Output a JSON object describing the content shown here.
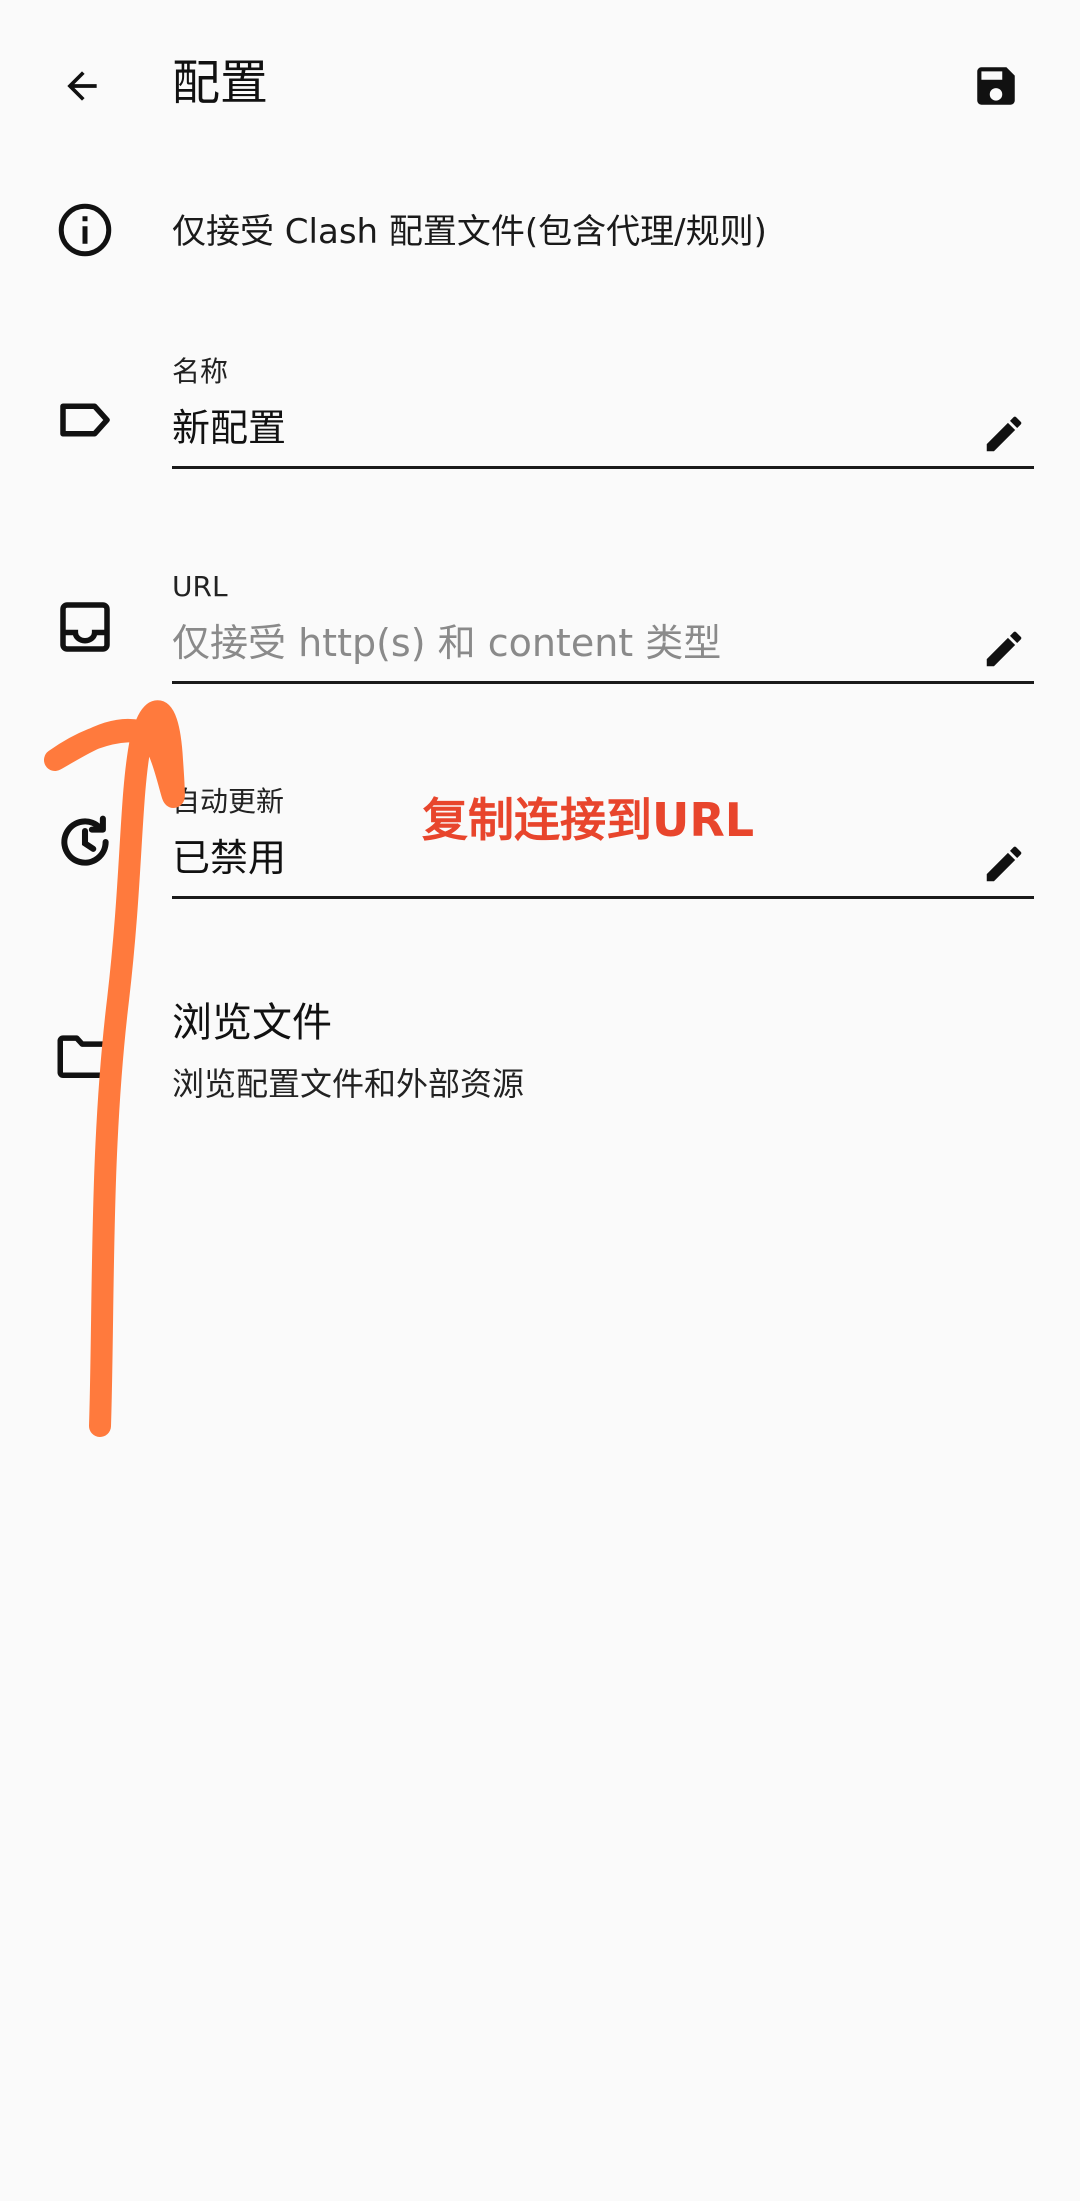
{
  "header": {
    "title": "配置",
    "back_icon": "arrow-left-icon",
    "save_icon": "save-icon"
  },
  "info": {
    "icon": "info-icon",
    "text": "仅接受 Clash 配置文件(包含代理/规则)"
  },
  "name_field": {
    "icon": "label-icon",
    "label": "名称",
    "value": "新配置",
    "edit_icon": "pencil-icon"
  },
  "url_field": {
    "icon": "inbox-icon",
    "label": "URL",
    "placeholder": "仅接受 http(s) 和 content 类型",
    "value": "",
    "edit_icon": "pencil-icon"
  },
  "auto_update_field": {
    "icon": "history-icon",
    "label": "自动更新",
    "value": "已禁用",
    "edit_icon": "pencil-icon"
  },
  "browse": {
    "icon": "folder-icon",
    "title": "浏览文件",
    "subtitle": "浏览配置文件和外部资源"
  },
  "annotation": {
    "text": "复制连接到URL",
    "text_color": "#e8452c",
    "stroke_color": "#ff7a3d"
  },
  "colors": {
    "background": "#fafafa",
    "foreground": "#111111",
    "placeholder": "#8a8a8a"
  }
}
